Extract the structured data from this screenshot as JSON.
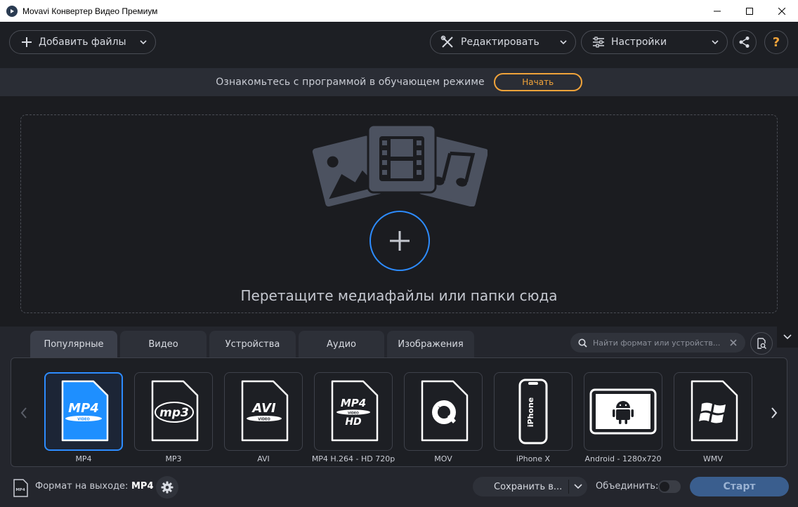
{
  "window": {
    "title": "Movavi Конвертер Видео Премиум",
    "controls": [
      "minimize-icon",
      "maximize-icon",
      "close-icon"
    ]
  },
  "toolbar": {
    "add_files_label": "Добавить файлы",
    "edit_label": "Редактировать",
    "settings_label": "Настройки",
    "help_glyph": "?"
  },
  "banner": {
    "text": "Ознакомьтесь с программой в обучающем режиме",
    "button_label": "Начать",
    "accent": "#f0a33a"
  },
  "dropzone": {
    "text": "Перетащите медиафайлы или папки сюда",
    "accent": "#2d8cff"
  },
  "tabs": [
    {
      "label": "Популярные",
      "active": true
    },
    {
      "label": "Видео",
      "active": false
    },
    {
      "label": "Устройства",
      "active": false
    },
    {
      "label": "Аудио",
      "active": false
    },
    {
      "label": "Изображения",
      "active": false
    }
  ],
  "search": {
    "placeholder": "Найти формат или устройств..."
  },
  "formats": [
    {
      "label": "MP4",
      "icon": "mp4-file-icon",
      "selected": true
    },
    {
      "label": "MP3",
      "icon": "mp3-file-icon",
      "selected": false
    },
    {
      "label": "AVI",
      "icon": "avi-file-icon",
      "selected": false
    },
    {
      "label": "MP4 H.264 - HD 720p",
      "icon": "mp4-hd-file-icon",
      "selected": false
    },
    {
      "label": "MOV",
      "icon": "quicktime-file-icon",
      "selected": false
    },
    {
      "label": "iPhone X",
      "icon": "iphone-icon",
      "selected": false
    },
    {
      "label": "Android - 1280x720",
      "icon": "android-tablet-icon",
      "selected": false
    },
    {
      "label": "WMV",
      "icon": "windows-file-icon",
      "selected": false
    }
  ],
  "output": {
    "label": "Формат на выходе:",
    "value": "MP4",
    "icon_text": "MP4"
  },
  "save": {
    "label": "Сохранить в..."
  },
  "merge": {
    "label": "Объединить:",
    "enabled": false
  },
  "start": {
    "label": "Старт",
    "color": "#3a5e8e"
  },
  "icon_texts": {
    "mp4": "MP4",
    "mp4_sub": "VIDEO",
    "mp3": "mp3",
    "avi": "AVI",
    "avi_sub": "VIDEO",
    "mp4hd": "MP4",
    "mp4hd_sub": "VIDEO",
    "mp4hd_hd": "HD",
    "iphone": "iPhone"
  }
}
